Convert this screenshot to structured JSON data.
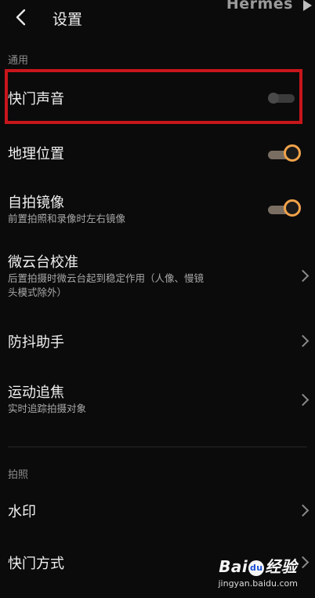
{
  "header": {
    "title": "设置",
    "back_icon": "chevron-left-icon",
    "overlay_text": "Hermes"
  },
  "sections": {
    "general": "通用",
    "photo": "拍照"
  },
  "rows": {
    "shutter_sound": {
      "title": "快门声音",
      "toggle": "off"
    },
    "location": {
      "title": "地理位置",
      "toggle": "on"
    },
    "selfie_mirror": {
      "title": "自拍镜像",
      "subtitle": "前置拍照和录像时左右镜像",
      "toggle": "on"
    },
    "gimbal_calibration": {
      "title": "微云台校准",
      "subtitle": "后置拍摄时微云台起到稳定作用（人像、慢镜头模式除外）"
    },
    "anti_shake": {
      "title": "防抖助手"
    },
    "motion_focus": {
      "title": "运动追焦",
      "subtitle": "实时追踪拍摄对象"
    },
    "watermark": {
      "title": "水印"
    },
    "shutter_mode": {
      "title": "快门方式"
    }
  },
  "watermark": {
    "logo_pre": "Bai",
    "logo_paw": "du",
    "logo_post": "经验",
    "url": "jingyan.baidu.com"
  },
  "colors": {
    "accent": "#f0a24a",
    "highlight": "#c7161b",
    "background": "#0b0b0b"
  }
}
